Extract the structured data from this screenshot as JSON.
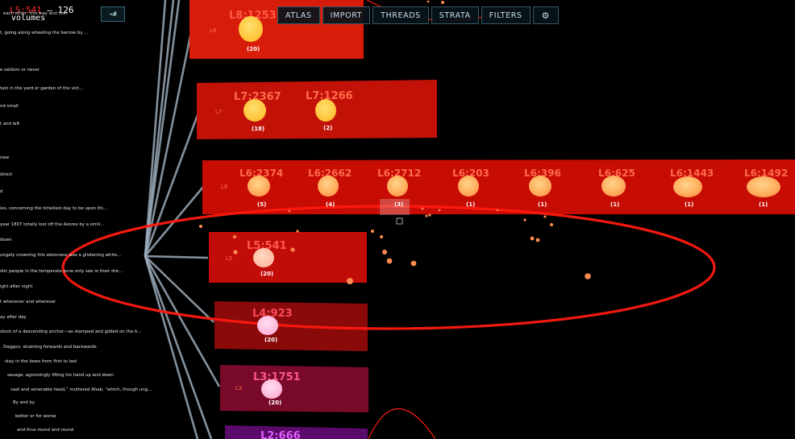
{
  "header": {
    "location": "L5:541",
    "separator": " — ",
    "count": "126",
    "subtitle": "volumes",
    "note": "each other, this way and that",
    "collapse_label": "→#"
  },
  "nav": {
    "items": [
      "ATLAS",
      "IMPORT",
      "THREADS",
      "STRATA",
      "FILTERS"
    ],
    "settings_icon": "gear-icon"
  },
  "excerpts": [
    "t, going along wheeling the barrow by ...",
    "e seldom or never",
    "tain in the yard or garden of the vict...",
    "nd small",
    "t and left",
    "new",
    "direct",
    "d",
    "ies, concerning the timeliest day to be upon thi...",
    "year 1807 totally lost off the Azores by a simil...",
    "down",
    "ungely crowning this ebonness was a glistening white...",
    "stic people in the temperate zone only see in their dre...",
    "ight after night",
    "t whenever and wherever",
    "ay after day",
    "stock of a descending anchor—as stamped and gilded on the b...",
    "Daggoo, straining forwards and backwards",
    "stay in the bows from first to last",
    "savage, agonizingly lifting his hand up and down",
    "vast and venerable head,” muttered Ahab, “which, though ung...",
    "By and by",
    "better or for worse",
    "and thus round and round"
  ],
  "strata": [
    {
      "layer": "L8",
      "color": "#d81c0a",
      "nodes": [
        {
          "label": "L8:1253",
          "count": "(20)"
        }
      ]
    },
    {
      "layer": "L7",
      "color": "#c21208",
      "nodes": [
        {
          "label": "L7:2367",
          "count": "(18)"
        },
        {
          "label": "L7:1266",
          "count": "(2)"
        }
      ]
    },
    {
      "layer": "L6",
      "color": "#c70c04",
      "nodes": [
        {
          "label": "L6:2374",
          "count": "(5)"
        },
        {
          "label": "L6:2662",
          "count": "(4)"
        },
        {
          "label": "L6:2712",
          "count": "(3)"
        },
        {
          "label": "L6:203",
          "count": "(1)"
        },
        {
          "label": "L6:396",
          "count": "(1)"
        },
        {
          "label": "L6:625",
          "count": "(1)"
        },
        {
          "label": "L6:1443",
          "count": "(1)"
        },
        {
          "label": "L6:1492",
          "count": "(1)"
        }
      ]
    },
    {
      "layer": "L5",
      "color": "#c20c08",
      "nodes": [
        {
          "label": "L5:541",
          "count": "(20)"
        }
      ]
    },
    {
      "layer": "L4",
      "color": "#8a0a0a",
      "nodes": [
        {
          "label": "L4:923",
          "count": "(20)"
        }
      ]
    },
    {
      "layer": "L3",
      "color": "#7a0a2a",
      "nodes": [
        {
          "label": "L3:1751",
          "count": "(20)"
        }
      ]
    },
    {
      "layer": "L2",
      "color": "#5a0a6a",
      "nodes": [
        {
          "label": "L2:666",
          "count": ""
        }
      ]
    }
  ],
  "colors": {
    "accent_red": "#ff2a1a",
    "node_fill": "#ffc070",
    "thread": "#9aaab8"
  }
}
